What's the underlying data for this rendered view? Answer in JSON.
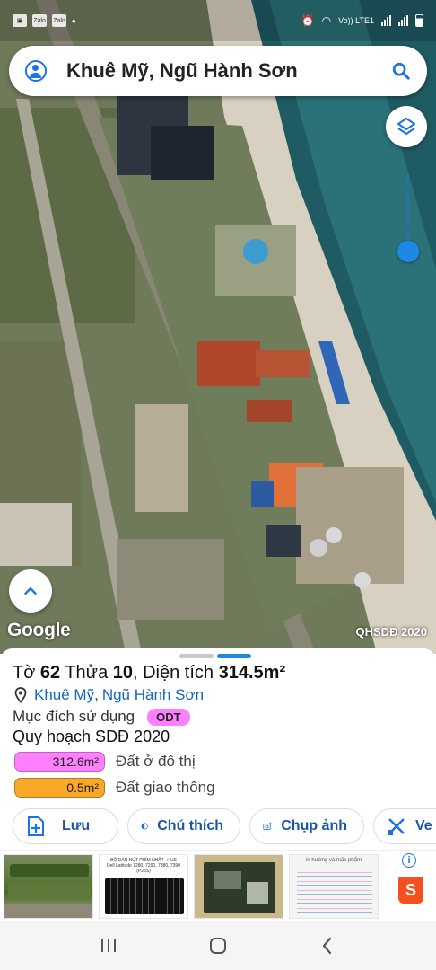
{
  "status_bar": {
    "left_icons": [
      "photo-icon",
      "zalo-icon",
      "zalo-icon",
      "dot-icon"
    ],
    "left_labels": [
      "",
      "Zalo",
      "Zalo",
      ""
    ],
    "network": "Vo)) LTE1",
    "battery_icon": "battery-icon"
  },
  "search": {
    "query": "Khuê Mỹ, Ngũ Hành Sơn"
  },
  "map": {
    "logo": "Google",
    "source_label": "QHSDĐ 2020",
    "opacity_level": 0.15
  },
  "parcel": {
    "prefix_to": "Tờ ",
    "to_number": "62",
    "prefix_thua": " Thửa ",
    "thua_number": "10",
    "prefix_area": ", Diện tích ",
    "area": "314.5m²",
    "ward": "Khuê Mỹ",
    "separator": ",",
    "district": "Ngũ Hành Sơn",
    "purpose_label": "Mục đích sử dụng",
    "purpose_code": "ODT",
    "plan_title": "Quy hoạch SDĐ 2020",
    "legend": [
      {
        "value": "312.6m²",
        "label": "Đất ở đô thị",
        "color": "#ff80ff"
      },
      {
        "value": "0.5m²",
        "label": "Đất giao thông",
        "color": "#f9a82a"
      }
    ]
  },
  "actions": [
    {
      "label": "Lưu",
      "icon": "save-add-icon"
    },
    {
      "label": "Chú thích",
      "icon": "legend-contrast-icon"
    },
    {
      "label": "Chụp ảnh",
      "icon": "camera-add-icon"
    },
    {
      "label": "Ve",
      "icon": "draw-icon"
    }
  ],
  "ads": [
    {
      "name": "ad-garden"
    },
    {
      "name": "ad-keyboard",
      "text": "BỘ DÁN NÚT PHÍM NHẬT -> US\nDell Latitude 7280, 7290, 7380, 7390 (P28S)"
    },
    {
      "name": "ad-motherboard"
    },
    {
      "name": "ad-sample-sheet",
      "text": "in hướng và mặc phẩm"
    }
  ],
  "colors": {
    "accent": "#1a73e8",
    "chip_text": "#1a56a8",
    "odt_pink": "#ff80ff",
    "road_orange": "#f9a82a"
  }
}
